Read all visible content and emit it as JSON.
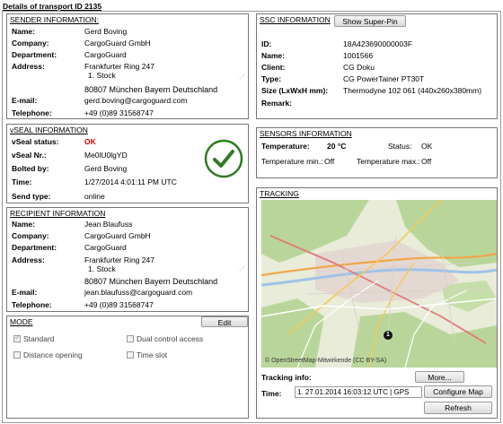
{
  "page_title": "Details of transport ID 2135",
  "sender": {
    "title": "SENDER INFORMATION:",
    "name_label": "Name:",
    "name": "Gerd Boving",
    "company_label": "Company:",
    "company": "CargoGuard GmbH",
    "department_label": "Department:",
    "department": "CargoGuard",
    "address_label": "Address:",
    "address_line1": "Frankfurter Ring 247",
    "address_line2": "1. Stock",
    "city_line": "80807  München  Bayern  Deutschland",
    "email_label": "E-mail:",
    "email": "gerd.boving@cargoguard.com",
    "telephone_label": "Telephone:",
    "telephone": "+49 (0)89 31568747"
  },
  "ssc": {
    "title": "SSC INFORMATION",
    "show_button": "Show Super-Pin",
    "id_label": "ID:",
    "id": "18A423690000003F",
    "name_label": "Name:",
    "name": "1001566",
    "client_label": "Client:",
    "client": "CG Doku",
    "type_label": "Type:",
    "type": "CG PowerTainer PT30T",
    "size_label": "Size (LxWxH mm):",
    "size": "Thermodyne 102 061 (440x260x380mm)",
    "remark_label": "Remark:",
    "remark": ""
  },
  "vseal": {
    "title": "vSEAL INFORMATION",
    "status_label": "vSeal status:",
    "status": "OK",
    "nr_label": "vSeal Nr.:",
    "nr": "Me0lU0lgYD",
    "bolted_label": "Bolted by:",
    "bolted": "Gerd Boving",
    "time_label": "Time:",
    "time": "1/27/2014 4:01:11 PM UTC",
    "send_type_label": "Send type:",
    "send_type": "online",
    "status_color": "#2e7d1f"
  },
  "sensors": {
    "title": "SENSORS INFORMATION",
    "temperature_label": "Temperature:",
    "temperature": "20 °C",
    "status_label": "Status:",
    "status": "OK",
    "temp_min_label": "Temperature min.:",
    "temp_min": "Off",
    "temp_max_label": "Temperature max.:",
    "temp_max": "Off"
  },
  "recipient": {
    "title": "RECIPIENT INFORMATION",
    "name_label": "Name:",
    "name": "Jean Blaufuss",
    "company_label": "Company:",
    "company": "CargoGuard GmbH",
    "department_label": "Department:",
    "department": "CargoGuard",
    "address_label": "Address:",
    "address_line1": "Frankfurter Ring 247",
    "address_line2": "1. Stock",
    "city_line": "80807  München  Bayern  Deutschland",
    "email_label": "E-mail:",
    "email": "jean.blaufuss@cargoguard.com",
    "telephone_label": "Telephone:",
    "telephone": "+49 (0)89 31568747"
  },
  "tracking": {
    "title": "TRACKING",
    "map_attribution": "© OpenStreetMap-Mitwirkende (CC BY-SA)",
    "marker_label": "1",
    "info_label": "Tracking info:",
    "more_button": "More...",
    "time_label": "Time:",
    "time_value": "1. 27.01.2014 16:03:12 UTC | GPS",
    "configure_button": "Configure Map",
    "refresh_button": "Refresh"
  },
  "mode": {
    "title": "MODE",
    "edit_button": "Edit",
    "options": [
      {
        "label": "Standard",
        "checked": true
      },
      {
        "label": "Dual control access",
        "checked": false
      },
      {
        "label": "Distance opening",
        "checked": false
      },
      {
        "label": "Time slot",
        "checked": false
      }
    ]
  }
}
